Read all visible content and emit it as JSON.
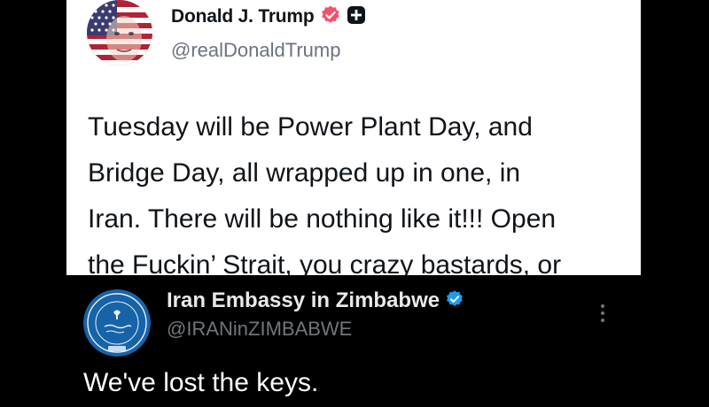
{
  "post_top": {
    "author_name": "Donald J. Trump",
    "handle": "@realDonaldTrump",
    "badges": [
      "verified-badge-icon",
      "plus-badge-icon"
    ],
    "body_lines": [
      "Tuesday will be Power Plant Day, and",
      "Bridge Day, all wrapped up in one, in",
      "Iran. There will be nothing like it!!! Open",
      "the Fuckin’ Strait, you crazy bastards, or"
    ],
    "colors": {
      "background": "#ffffff",
      "verified": "#f4516c",
      "text": "#0f1419"
    }
  },
  "post_bottom": {
    "author_name": "Iran Embassy in Zimbabwe",
    "handle": "@IRANinZIMBABWE",
    "badge": "verified-badge-icon",
    "more_icon": "more-vertical-icon",
    "body": "We've lost the keys.",
    "colors": {
      "background": "#000000",
      "verified": "#1d9bf0",
      "text": "#ffffff"
    }
  }
}
